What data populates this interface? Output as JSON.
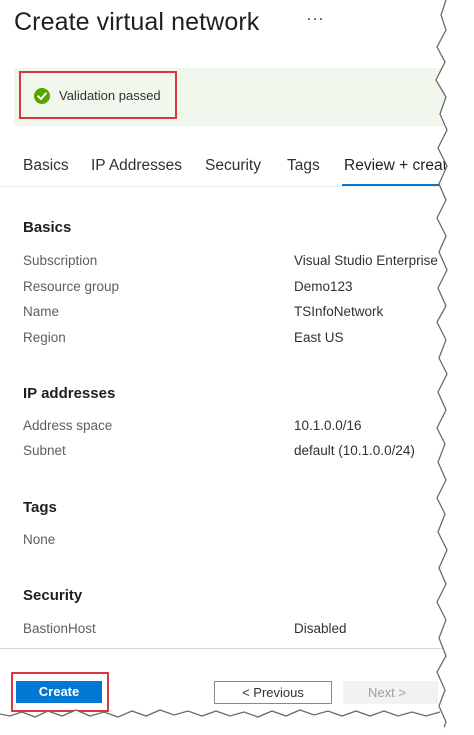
{
  "header": {
    "title": "Create virtual network",
    "more_icon": "···"
  },
  "validation": {
    "status_text": "Validation passed",
    "status_color": "#57a300"
  },
  "tabs": [
    {
      "label": "Basics"
    },
    {
      "label": "IP Addresses"
    },
    {
      "label": "Security"
    },
    {
      "label": "Tags"
    },
    {
      "label": "Review + create",
      "active": true
    }
  ],
  "sections": {
    "basics": {
      "title": "Basics",
      "rows": [
        {
          "label": "Subscription",
          "value": "Visual Studio Enterprise"
        },
        {
          "label": "Resource group",
          "value": "Demo123"
        },
        {
          "label": "Name",
          "value": "TSInfoNetwork"
        },
        {
          "label": "Region",
          "value": "East US"
        }
      ]
    },
    "ip_addresses": {
      "title": "IP addresses",
      "rows": [
        {
          "label": "Address space",
          "value": "10.1.0.0/16"
        },
        {
          "label": "Subnet",
          "value": "default (10.1.0.0/24)"
        }
      ]
    },
    "tags": {
      "title": "Tags",
      "value": "None"
    },
    "security": {
      "title": "Security",
      "rows": [
        {
          "label": "BastionHost",
          "value": "Disabled"
        }
      ]
    }
  },
  "footer": {
    "create_label": "Create",
    "previous_label": "< Previous",
    "next_label": "Next >"
  },
  "colors": {
    "accent": "#0078d4",
    "highlight_box": "#d9363e",
    "banner_bg": "#f1f7ec"
  }
}
